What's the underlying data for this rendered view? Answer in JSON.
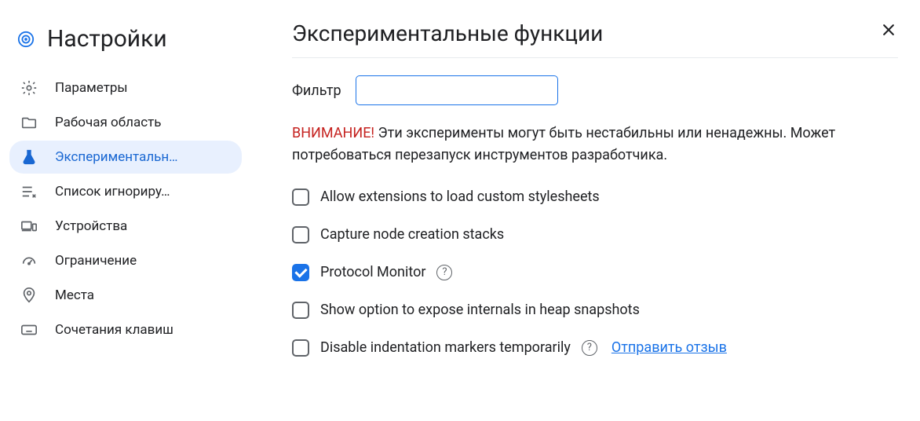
{
  "header": {
    "title": "Настройки"
  },
  "sidebar": {
    "items": [
      {
        "label": "Параметры"
      },
      {
        "label": "Рабочая область"
      },
      {
        "label": "Экспериментальн…",
        "active": true
      },
      {
        "label": "Список игнориру…"
      },
      {
        "label": "Устройства"
      },
      {
        "label": "Ограничение"
      },
      {
        "label": "Места"
      },
      {
        "label": "Сочетания клавиш"
      }
    ]
  },
  "main": {
    "title": "Экспериментальные функции",
    "filter_label": "Фильтр",
    "filter_value": "",
    "warning_label": "ВНИМАНИЕ!",
    "warning_text": " Эти эксперименты могут быть нестабильны или ненадежны. Может потребоваться перезапуск инструментов разработчика.",
    "experiments": [
      {
        "label": "Allow extensions to load custom stylesheets",
        "checked": false,
        "help": false
      },
      {
        "label": "Capture node creation stacks",
        "checked": false,
        "help": false
      },
      {
        "label": "Protocol Monitor",
        "checked": true,
        "help": true
      },
      {
        "label": "Show option to expose internals in heap snapshots",
        "checked": false,
        "help": false
      },
      {
        "label": "Disable indentation markers temporarily",
        "checked": false,
        "help": true,
        "feedback": true
      }
    ],
    "feedback_link": "Отправить отзыв"
  }
}
